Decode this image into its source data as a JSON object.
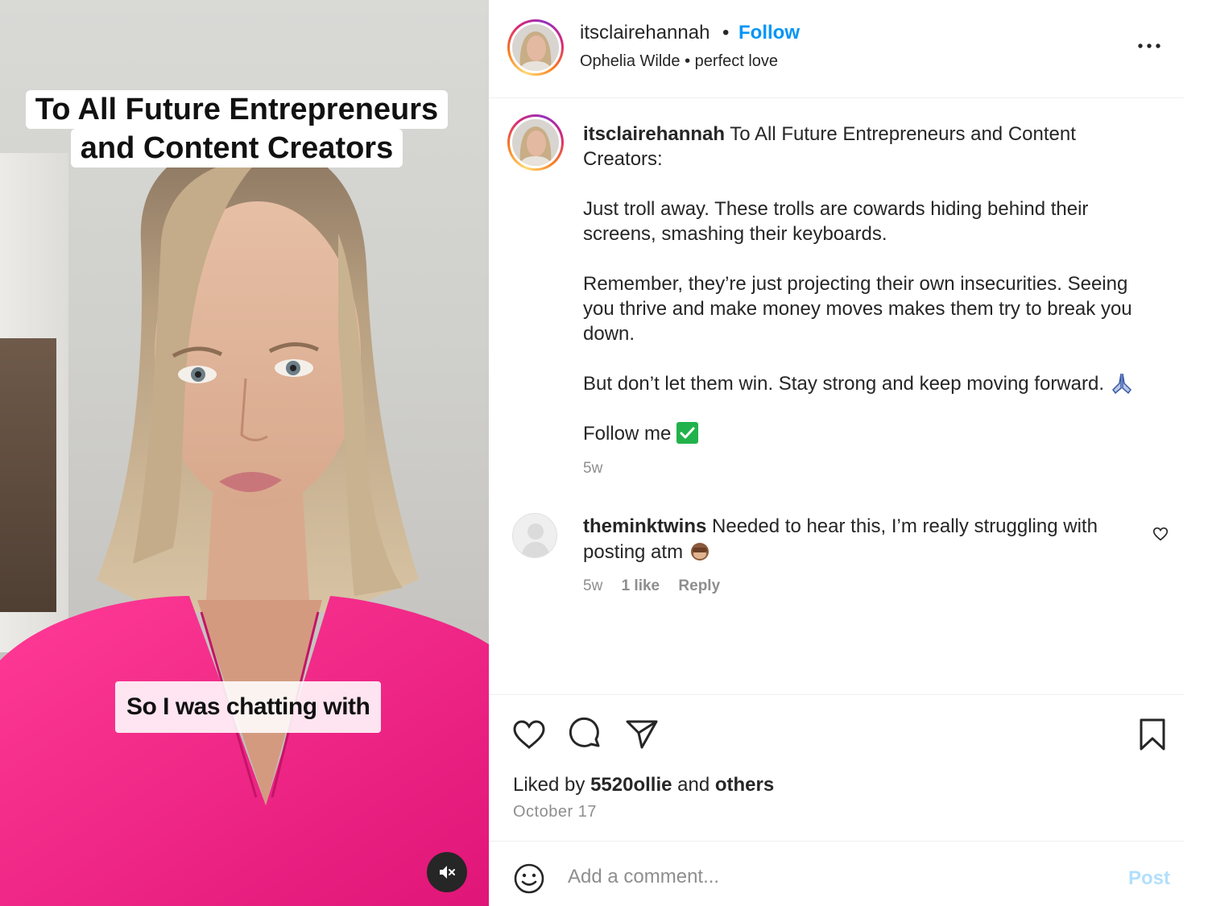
{
  "video": {
    "caption_top_line1": "To All Future Entrepreneurs",
    "caption_top_line2": "and Content Creators",
    "caption_bottom": "So I was chatting with",
    "mute_icon": "muted-speaker-icon"
  },
  "header": {
    "username": "itsclairehannah",
    "separator": "•",
    "follow_label": "Follow",
    "audio_artist": "Ophelia Wilde",
    "audio_separator": "•",
    "audio_track": "perfect love",
    "more_icon": "more-options-icon"
  },
  "caption": {
    "username": "itsclairehannah",
    "intro": "To All Future Entrepreneurs and Content Creators:",
    "para1": "Just troll away. These trolls are cowards hiding behind their screens, smashing their keyboards.",
    "para2": "Remember, they’re just projecting their own insecurities. Seeing you thrive and make money moves makes them try to break you down.",
    "para3": "But don’t let them win. Stay strong and keep moving forward.",
    "para4": "Follow me",
    "time": "5w"
  },
  "comment": {
    "username": "theminktwins",
    "text": "Needed to hear this, I’m really struggling with posting atm",
    "time": "5w",
    "likes": "1 like",
    "reply_label": "Reply"
  },
  "actions": {
    "liked_prefix": "Liked by",
    "liked_user": "5520ollie",
    "liked_and": "and",
    "liked_others": "others",
    "date": "October 17"
  },
  "add_comment": {
    "placeholder": "Add a comment...",
    "post_label": "Post"
  },
  "colors": {
    "follow_blue": "#0095f6",
    "post_disabled": "#b2dffc",
    "shirt_pink": "#f0207e",
    "muted_text": "#8e8e8e"
  }
}
